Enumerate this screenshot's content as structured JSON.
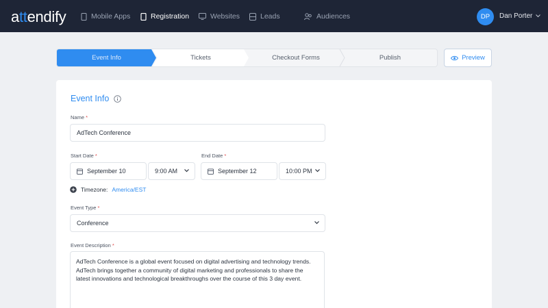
{
  "app": {
    "logo_a": "a",
    "logo_tt": "tt",
    "logo_rest": "endify"
  },
  "nav": {
    "items": [
      {
        "label": "Mobile Apps",
        "icon": "phone-icon"
      },
      {
        "label": "Registration",
        "icon": "clipboard-icon",
        "active": true
      },
      {
        "label": "Websites",
        "icon": "monitor-icon"
      },
      {
        "label": "Leads",
        "icon": "database-icon"
      },
      {
        "label": "Audiences",
        "icon": "people-icon"
      }
    ],
    "avatar_initials": "DP",
    "user_name": "Dan Porter"
  },
  "steps": [
    {
      "label": "Event Info",
      "active": true
    },
    {
      "label": "Tickets"
    },
    {
      "label": "Checkout Forms"
    },
    {
      "label": "Publish"
    }
  ],
  "preview_label": "Preview",
  "form": {
    "title": "Event Info",
    "name_label": "Name",
    "name_value": "AdTech Conference",
    "start_date_label": "Start Date",
    "start_date_value": "September 10",
    "start_time_value": "9:00 AM",
    "end_date_label": "End Date",
    "end_date_value": "September 12",
    "end_time_value": "10:00 PM",
    "timezone_label": "Timezone:",
    "timezone_value": "America/EST",
    "event_type_label": "Event Type",
    "event_type_value": "Conference",
    "description_label": "Event Description",
    "description_value": "AdTech Conference is a global event focused on digital advertising and technology trends. AdTech brings together a community of digital marketing and professionals to share the latest innovations and technological breakthroughs over the course of this 3 day event.",
    "required_mark": "*"
  },
  "colors": {
    "accent": "#2f8cf0",
    "nav_bg": "#1e2536",
    "page_bg": "#eef0f3"
  }
}
